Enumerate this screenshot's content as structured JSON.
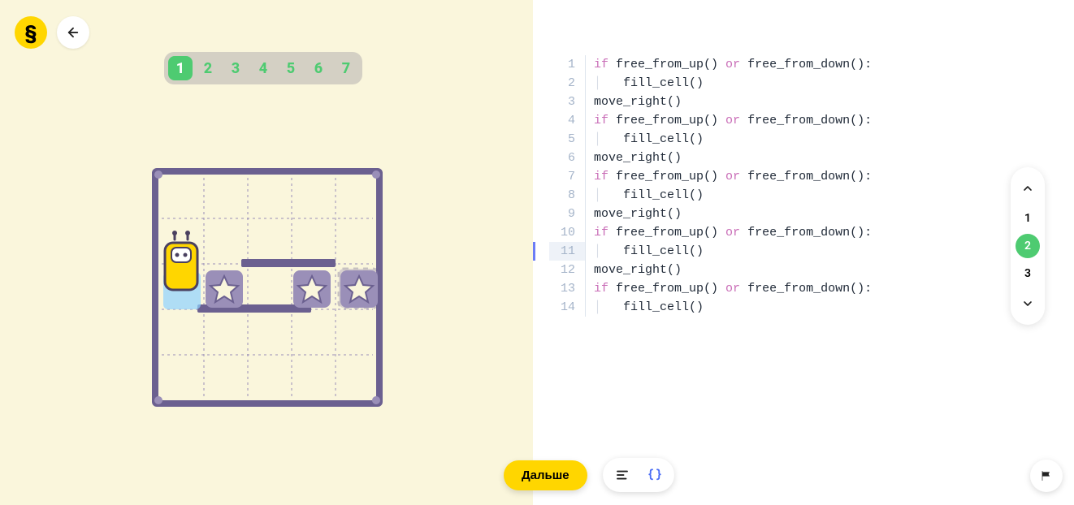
{
  "header": {
    "logo_glyph": "§"
  },
  "steps": {
    "items": [
      "1",
      "2",
      "3",
      "4",
      "5",
      "6",
      "7"
    ],
    "active_index": 0
  },
  "code": {
    "lines": [
      {
        "n": "1",
        "indent": 0,
        "tokens": [
          {
            "t": "if ",
            "c": "kw-if"
          },
          {
            "t": "free_from_up() "
          },
          {
            "t": "or ",
            "c": "kw-or"
          },
          {
            "t": "free_from_down():"
          }
        ]
      },
      {
        "n": "2",
        "indent": 1,
        "tokens": [
          {
            "t": "fill_cell()"
          }
        ]
      },
      {
        "n": "3",
        "indent": 0,
        "tokens": [
          {
            "t": "move_right()"
          }
        ]
      },
      {
        "n": "4",
        "indent": 0,
        "tokens": [
          {
            "t": "if ",
            "c": "kw-if"
          },
          {
            "t": "free_from_up() "
          },
          {
            "t": "or ",
            "c": "kw-or"
          },
          {
            "t": "free_from_down():"
          }
        ]
      },
      {
        "n": "5",
        "indent": 1,
        "tokens": [
          {
            "t": "fill_cell()"
          }
        ]
      },
      {
        "n": "6",
        "indent": 0,
        "tokens": [
          {
            "t": "move_right()"
          }
        ]
      },
      {
        "n": "7",
        "indent": 0,
        "tokens": [
          {
            "t": "if ",
            "c": "kw-if"
          },
          {
            "t": "free_from_up() "
          },
          {
            "t": "or ",
            "c": "kw-or"
          },
          {
            "t": "free_from_down():"
          }
        ]
      },
      {
        "n": "8",
        "indent": 1,
        "tokens": [
          {
            "t": "fill_cell()"
          }
        ]
      },
      {
        "n": "9",
        "indent": 0,
        "tokens": [
          {
            "t": "move_right()"
          }
        ]
      },
      {
        "n": "10",
        "indent": 0,
        "tokens": [
          {
            "t": "if ",
            "c": "kw-if"
          },
          {
            "t": "free_from_up() "
          },
          {
            "t": "or ",
            "c": "kw-or"
          },
          {
            "t": "free_from_down():"
          }
        ]
      },
      {
        "n": "11",
        "indent": 1,
        "tokens": [
          {
            "t": "fill_cell()"
          }
        ],
        "highlight": true
      },
      {
        "n": "12",
        "indent": 0,
        "tokens": [
          {
            "t": "move_right()"
          }
        ]
      },
      {
        "n": "13",
        "indent": 0,
        "tokens": [
          {
            "t": "if ",
            "c": "kw-if"
          },
          {
            "t": "free_from_up() "
          },
          {
            "t": "or ",
            "c": "kw-or"
          },
          {
            "t": "free_from_down():"
          }
        ]
      },
      {
        "n": "14",
        "indent": 1,
        "tokens": [
          {
            "t": "fill_cell()"
          }
        ]
      }
    ]
  },
  "side_nav": {
    "items": [
      "1",
      "2",
      "3"
    ],
    "active_index": 1
  },
  "bottom": {
    "next_label": "Дальше"
  }
}
